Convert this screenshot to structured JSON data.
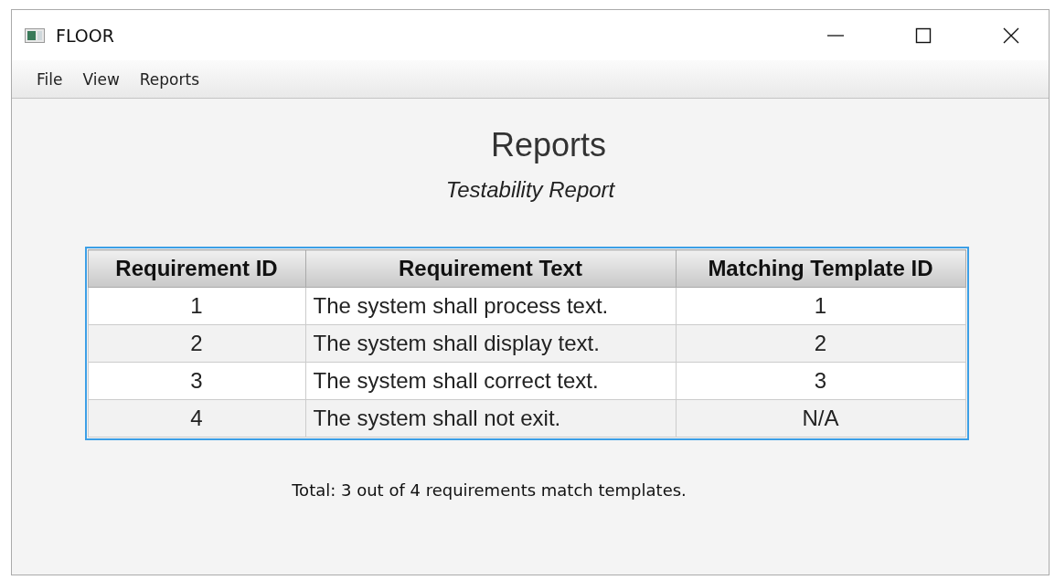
{
  "window": {
    "title": "FLOOR"
  },
  "menu": [
    "File",
    "View",
    "Reports"
  ],
  "heading": "Reports",
  "subheading": "Testability Report",
  "table": {
    "columns": [
      "Requirement ID",
      "Requirement Text",
      "Matching Template ID"
    ],
    "rows": [
      {
        "cells": [
          "1",
          "The system shall process text.",
          "1"
        ]
      },
      {
        "cells": [
          "2",
          "The system shall display text.",
          "2"
        ]
      },
      {
        "cells": [
          "3",
          "The system shall correct text.",
          "3"
        ]
      },
      {
        "cells": [
          "4",
          "The system shall not exit.",
          "N/A"
        ]
      }
    ]
  },
  "summary": "Total: 3 out of 4 requirements match templates."
}
